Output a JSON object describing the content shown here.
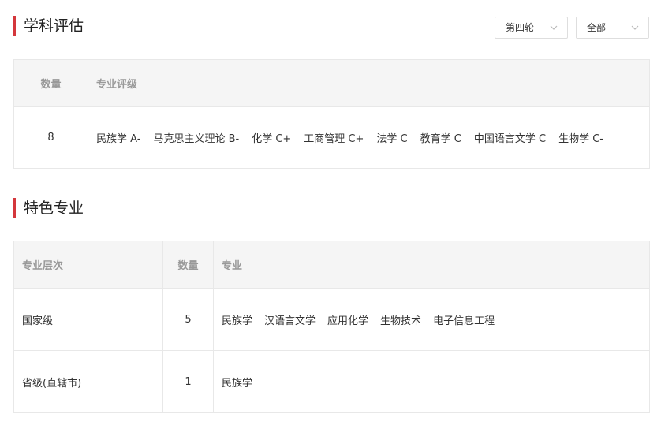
{
  "eval_section": {
    "title": "学科评估",
    "round_select": {
      "value": "第四轮"
    },
    "scope_select": {
      "value": "全部"
    },
    "headers": {
      "count": "数量",
      "grade": "专业评级"
    },
    "row": {
      "count": "8",
      "items": [
        "民族学 A-",
        "马克思主义理论 B-",
        "化学 C+",
        "工商管理 C+",
        "法学 C",
        "教育学 C",
        "中国语言文学 C",
        "生物学 C-"
      ]
    }
  },
  "feature_section": {
    "title": "特色专业",
    "headers": {
      "level": "专业层次",
      "count": "数量",
      "major": "专业"
    },
    "rows": [
      {
        "level": "国家级",
        "count": "5",
        "majors": [
          "民族学",
          "汉语言文学",
          "应用化学",
          "生物技术",
          "电子信息工程"
        ]
      },
      {
        "level": "省级(直辖市)",
        "count": "1",
        "majors": [
          "民族学"
        ]
      }
    ]
  }
}
